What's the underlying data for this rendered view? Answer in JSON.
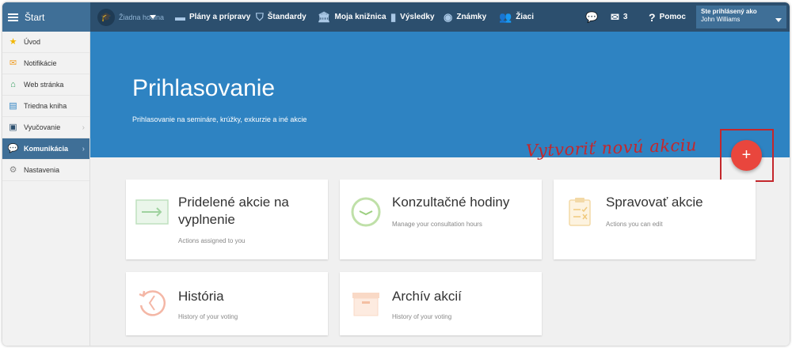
{
  "topbar": {
    "start_label": "Štart",
    "lesson_label": "Žiadna hodina",
    "nav": [
      {
        "label": "Plány a prípravy",
        "icon": "briefcase-icon"
      },
      {
        "label": "Štandardy",
        "icon": "shield-icon"
      },
      {
        "label": "Moja knižnica",
        "icon": "library-icon"
      },
      {
        "label": "Výsledky",
        "icon": "bar-chart-icon"
      },
      {
        "label": "Známky",
        "icon": "grade-icon"
      },
      {
        "label": "Žiaci",
        "icon": "students-icon"
      }
    ],
    "messages_count": "3",
    "help_label": "Pomoc",
    "user": {
      "caption": "Ste prihlásený ako",
      "name": "John Williams"
    }
  },
  "sidebar": {
    "items": [
      {
        "label": "Úvod",
        "icon": "star-icon"
      },
      {
        "label": "Notifikácie",
        "icon": "envelope-icon"
      },
      {
        "label": "Web stránka",
        "icon": "home-icon"
      },
      {
        "label": "Triedna kniha",
        "icon": "book-icon"
      },
      {
        "label": "Vyučovanie",
        "icon": "teaching-icon"
      },
      {
        "label": "Komunikácia",
        "icon": "chat-icon"
      },
      {
        "label": "Nastavenia",
        "icon": "gear-icon"
      }
    ]
  },
  "hero": {
    "title": "Prihlasovanie",
    "subtitle": "Prihlasovanie na semináre, krúžky, exkurzie a iné akcie"
  },
  "annotation": "Vytvoriť novú akciu",
  "fab_label": "+",
  "cards": [
    {
      "title": "Pridelené akcie na vyplnenie",
      "subtitle": "Actions assigned to you"
    },
    {
      "title": "Konzultačné hodiny",
      "subtitle": "Manage your consultation hours"
    },
    {
      "title": "Spravovať akcie",
      "subtitle": "Actions you can edit"
    },
    {
      "title": "História",
      "subtitle": "History of your voting"
    },
    {
      "title": "Archív akcií",
      "subtitle": "History of your voting"
    }
  ],
  "colors": {
    "topbar": "#2c4f6e",
    "hero": "#2e83c2",
    "fab": "#e9463d",
    "annotation": "#c4272c"
  }
}
